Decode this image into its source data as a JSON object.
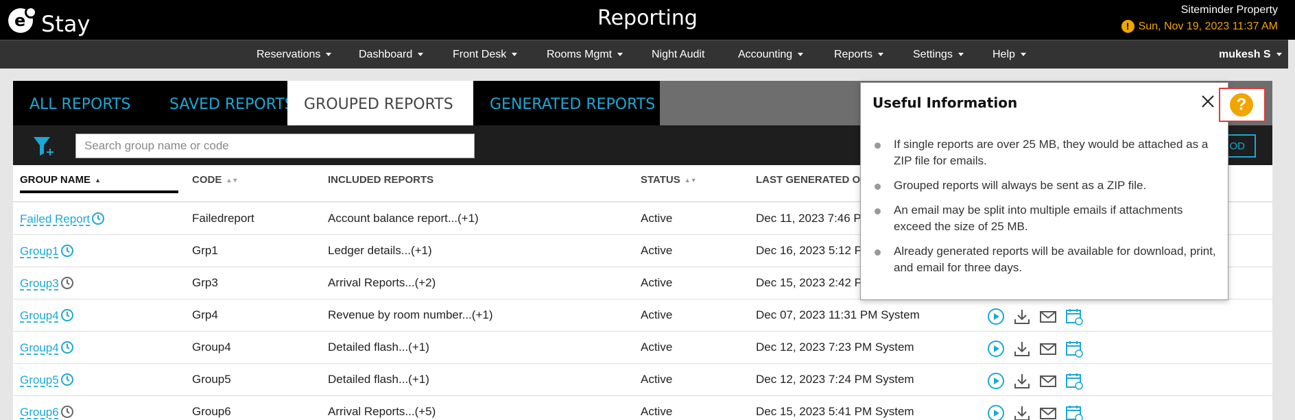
{
  "header": {
    "logo_text": "Stay",
    "title": "Reporting",
    "property_name": "Siteminder Property",
    "datetime": "Sun, Nov 19, 2023 11:37 AM",
    "warning_icon": "!"
  },
  "nav": {
    "items": [
      {
        "label": "Reservations",
        "dropdown": true
      },
      {
        "label": "Dashboard",
        "dropdown": true
      },
      {
        "label": "Front Desk",
        "dropdown": true
      },
      {
        "label": "Rooms Mgmt",
        "dropdown": true
      },
      {
        "label": "Night Audit",
        "dropdown": false
      },
      {
        "label": "Accounting",
        "dropdown": true
      },
      {
        "label": "Reports",
        "dropdown": true
      },
      {
        "label": "Settings",
        "dropdown": true
      },
      {
        "label": "Help",
        "dropdown": true
      }
    ],
    "user": "mukesh S"
  },
  "tabs": [
    {
      "label": "ALL REPORTS",
      "active": false
    },
    {
      "label": "SAVED REPORTS",
      "active": false
    },
    {
      "label": "GROUPED REPORTS",
      "active": true
    },
    {
      "label": "GENERATED REPORTS",
      "active": false
    }
  ],
  "toolbar": {
    "search_placeholder": "Search group name or code",
    "add_label": "OD"
  },
  "table": {
    "columns": [
      "GROUP NAME",
      "CODE",
      "INCLUDED REPORTS",
      "STATUS",
      "LAST GENERATED ON"
    ],
    "rows": [
      {
        "group": "Failed Report",
        "code": "Failedreport",
        "included": "Account balance report...(+1)",
        "status": "Active",
        "last": "Dec 11, 2023 7:46 P",
        "clock": "blue",
        "actions": false
      },
      {
        "group": "Group1",
        "code": "Grp1",
        "included": "Ledger details...(+1)",
        "status": "Active",
        "last": "Dec 16, 2023 5:12 P",
        "clock": "blue",
        "actions": false
      },
      {
        "group": "Group3",
        "code": "Grp3",
        "included": "Arrival Reports...(+2)",
        "status": "Active",
        "last": "Dec 15, 2023 2:42 P",
        "clock": "gray",
        "actions": false
      },
      {
        "group": "Group4",
        "code": "Grp4",
        "included": "Revenue by room number...(+1)",
        "status": "Active",
        "last": "Dec 07, 2023 11:31 PM System",
        "clock": "blue",
        "actions": true
      },
      {
        "group": "Group4",
        "code": "Group4",
        "included": "Detailed flash...(+1)",
        "status": "Active",
        "last": "Dec 12, 2023 7:23 PM System",
        "clock": "blue",
        "actions": true
      },
      {
        "group": "Group5",
        "code": "Group5",
        "included": "Detailed flash...(+1)",
        "status": "Active",
        "last": "Dec 12, 2023 7:24 PM System",
        "clock": "blue",
        "actions": true
      },
      {
        "group": "Group6",
        "code": "Group6",
        "included": "Arrival Reports...(+5)",
        "status": "Active",
        "last": "Dec 15, 2023 5:41 PM System",
        "clock": "gray",
        "actions": true
      }
    ]
  },
  "popover": {
    "title": "Useful Information",
    "items": [
      "If single reports are over 25 MB, they would be attached as a ZIP file for emails.",
      "Grouped reports will always be sent as a ZIP file.",
      "An email may be split into multiple emails if attachments exceed the size of 25 MB.",
      "Already generated reports will be available for download, print, and email for three days."
    ]
  },
  "help_icon": "?",
  "colors": {
    "accent": "#1ba8d6",
    "warning": "#f0a500",
    "highlight": "#e03a3a"
  }
}
